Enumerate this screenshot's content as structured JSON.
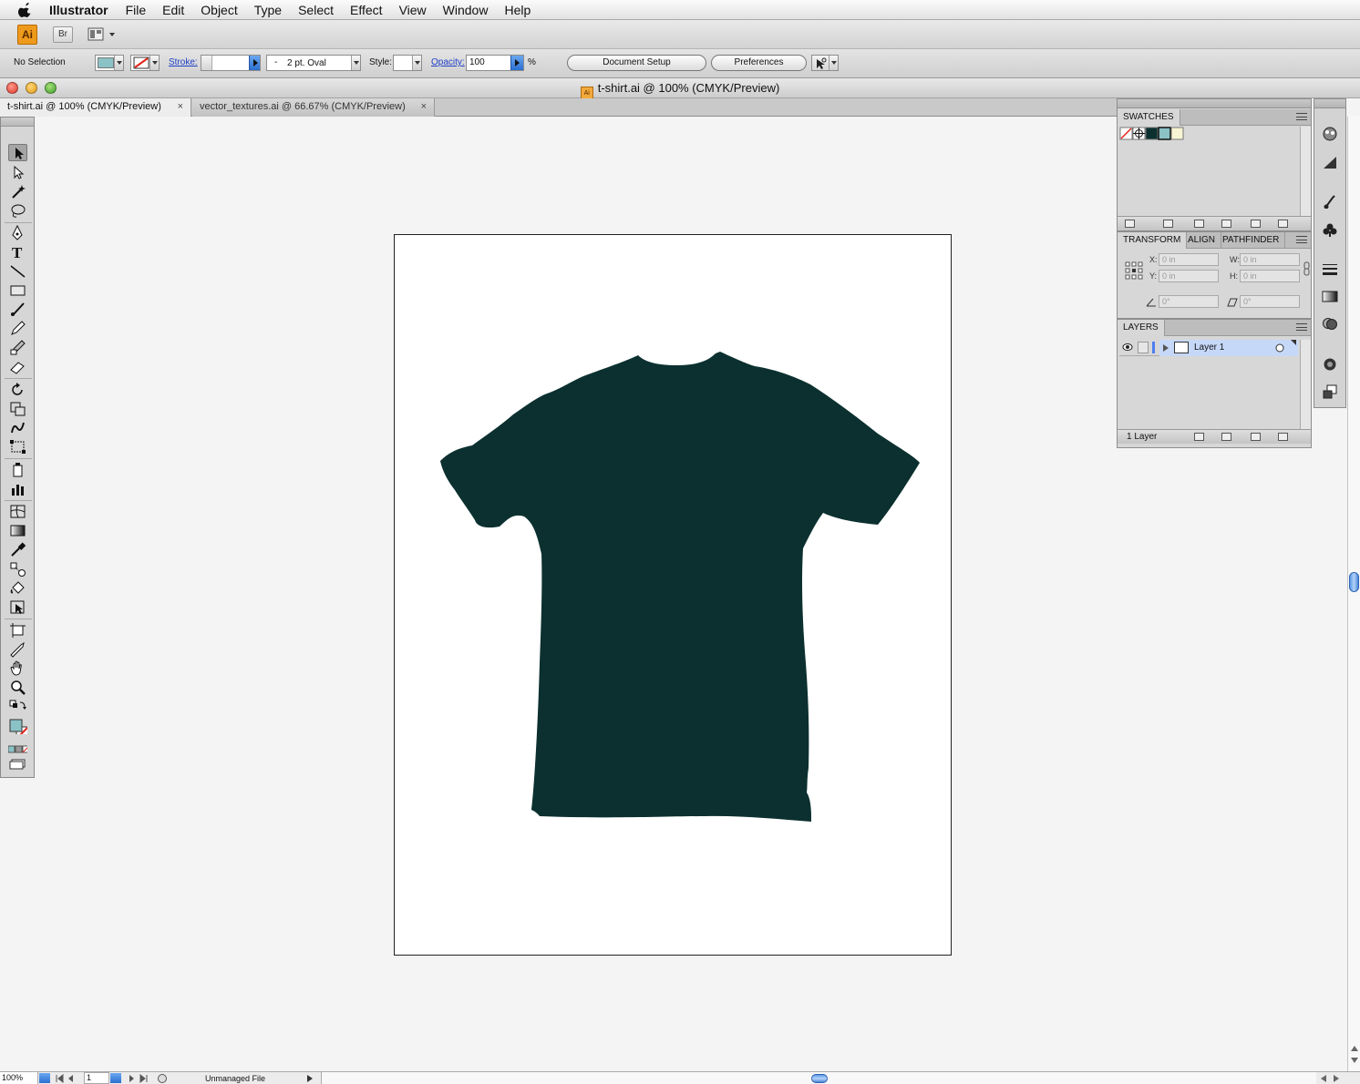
{
  "menubar": {
    "app_name": "Illustrator",
    "items": [
      "File",
      "Edit",
      "Object",
      "Type",
      "Select",
      "Effect",
      "View",
      "Window",
      "Help"
    ]
  },
  "appbar": {
    "logo": "Ai",
    "bridge": "Br"
  },
  "controlbar": {
    "selection": "No Selection",
    "stroke_label": "Stroke:",
    "brush_value": "2 pt. Oval",
    "brush_prefix": "-",
    "style_label": "Style:",
    "opacity_label": "Opacity:",
    "opacity_value": "100",
    "percent": "%",
    "document_setup": "Document Setup",
    "preferences": "Preferences",
    "fill_color": "#8bc2c6"
  },
  "window": {
    "title": "t-shirt.ai @ 100% (CMYK/Preview)",
    "doc_icon": "Ai"
  },
  "tabs": [
    {
      "label": "t-shirt.ai @ 100% (CMYK/Preview)",
      "close": "×"
    },
    {
      "label": "vector_textures.ai @ 66.67% (CMYK/Preview)",
      "close": "×"
    }
  ],
  "artwork": {
    "tshirt_color": "#0b302f"
  },
  "panels": {
    "swatches": {
      "title": "SWATCHES"
    },
    "transform": {
      "tabs": [
        "TRANSFORM",
        "ALIGN",
        "PATHFINDER"
      ],
      "x_label": "X:",
      "y_label": "Y:",
      "w_label": "W:",
      "h_label": "H:",
      "x": "0 in",
      "y": "0 in",
      "w": "0 in",
      "h": "0 in",
      "angle": "0°",
      "shear": "0°"
    },
    "layers": {
      "title": "LAYERS",
      "layer_name": "Layer 1",
      "count": "1 Layer"
    }
  },
  "status": {
    "zoom": "100%",
    "page": "1",
    "info": "Unmanaged File"
  }
}
